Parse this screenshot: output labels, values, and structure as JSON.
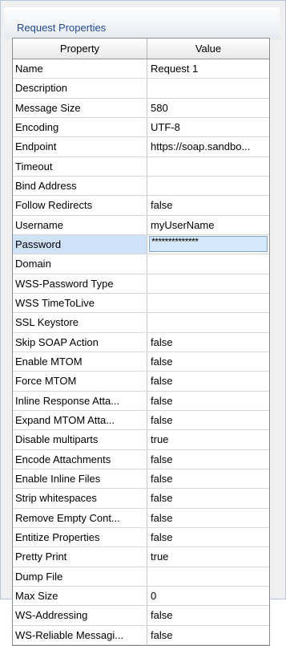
{
  "panel": {
    "title": "Request Properties"
  },
  "table": {
    "headers": {
      "property": "Property",
      "value": "Value"
    },
    "rows": [
      {
        "property": "Name",
        "value": "Request 1"
      },
      {
        "property": "Description",
        "value": ""
      },
      {
        "property": "Message Size",
        "value": "580"
      },
      {
        "property": "Encoding",
        "value": "UTF-8"
      },
      {
        "property": "Endpoint",
        "value": "https://soap.sandbo..."
      },
      {
        "property": "Timeout",
        "value": ""
      },
      {
        "property": "Bind Address",
        "value": ""
      },
      {
        "property": "Follow Redirects",
        "value": "false"
      },
      {
        "property": "Username",
        "value": "myUserName"
      },
      {
        "property": "Password",
        "value": "**************",
        "selected": true
      },
      {
        "property": "Domain",
        "value": ""
      },
      {
        "property": "WSS-Password Type",
        "value": ""
      },
      {
        "property": "WSS TimeToLive",
        "value": ""
      },
      {
        "property": "SSL Keystore",
        "value": ""
      },
      {
        "property": "Skip SOAP Action",
        "value": "false"
      },
      {
        "property": "Enable MTOM",
        "value": "false"
      },
      {
        "property": "Force MTOM",
        "value": "false"
      },
      {
        "property": "Inline Response Atta...",
        "value": "false"
      },
      {
        "property": "Expand MTOM Atta...",
        "value": "false"
      },
      {
        "property": "Disable multiparts",
        "value": "true"
      },
      {
        "property": "Encode Attachments",
        "value": "false"
      },
      {
        "property": "Enable Inline Files",
        "value": "false"
      },
      {
        "property": "Strip whitespaces",
        "value": "false"
      },
      {
        "property": "Remove Empty Cont...",
        "value": "false"
      },
      {
        "property": "Entitize Properties",
        "value": "false"
      },
      {
        "property": "Pretty Print",
        "value": "true"
      },
      {
        "property": "Dump File",
        "value": ""
      },
      {
        "property": "Max Size",
        "value": "0"
      },
      {
        "property": "WS-Addressing",
        "value": "false"
      },
      {
        "property": "WS-Reliable Messagi...",
        "value": "false"
      }
    ]
  }
}
